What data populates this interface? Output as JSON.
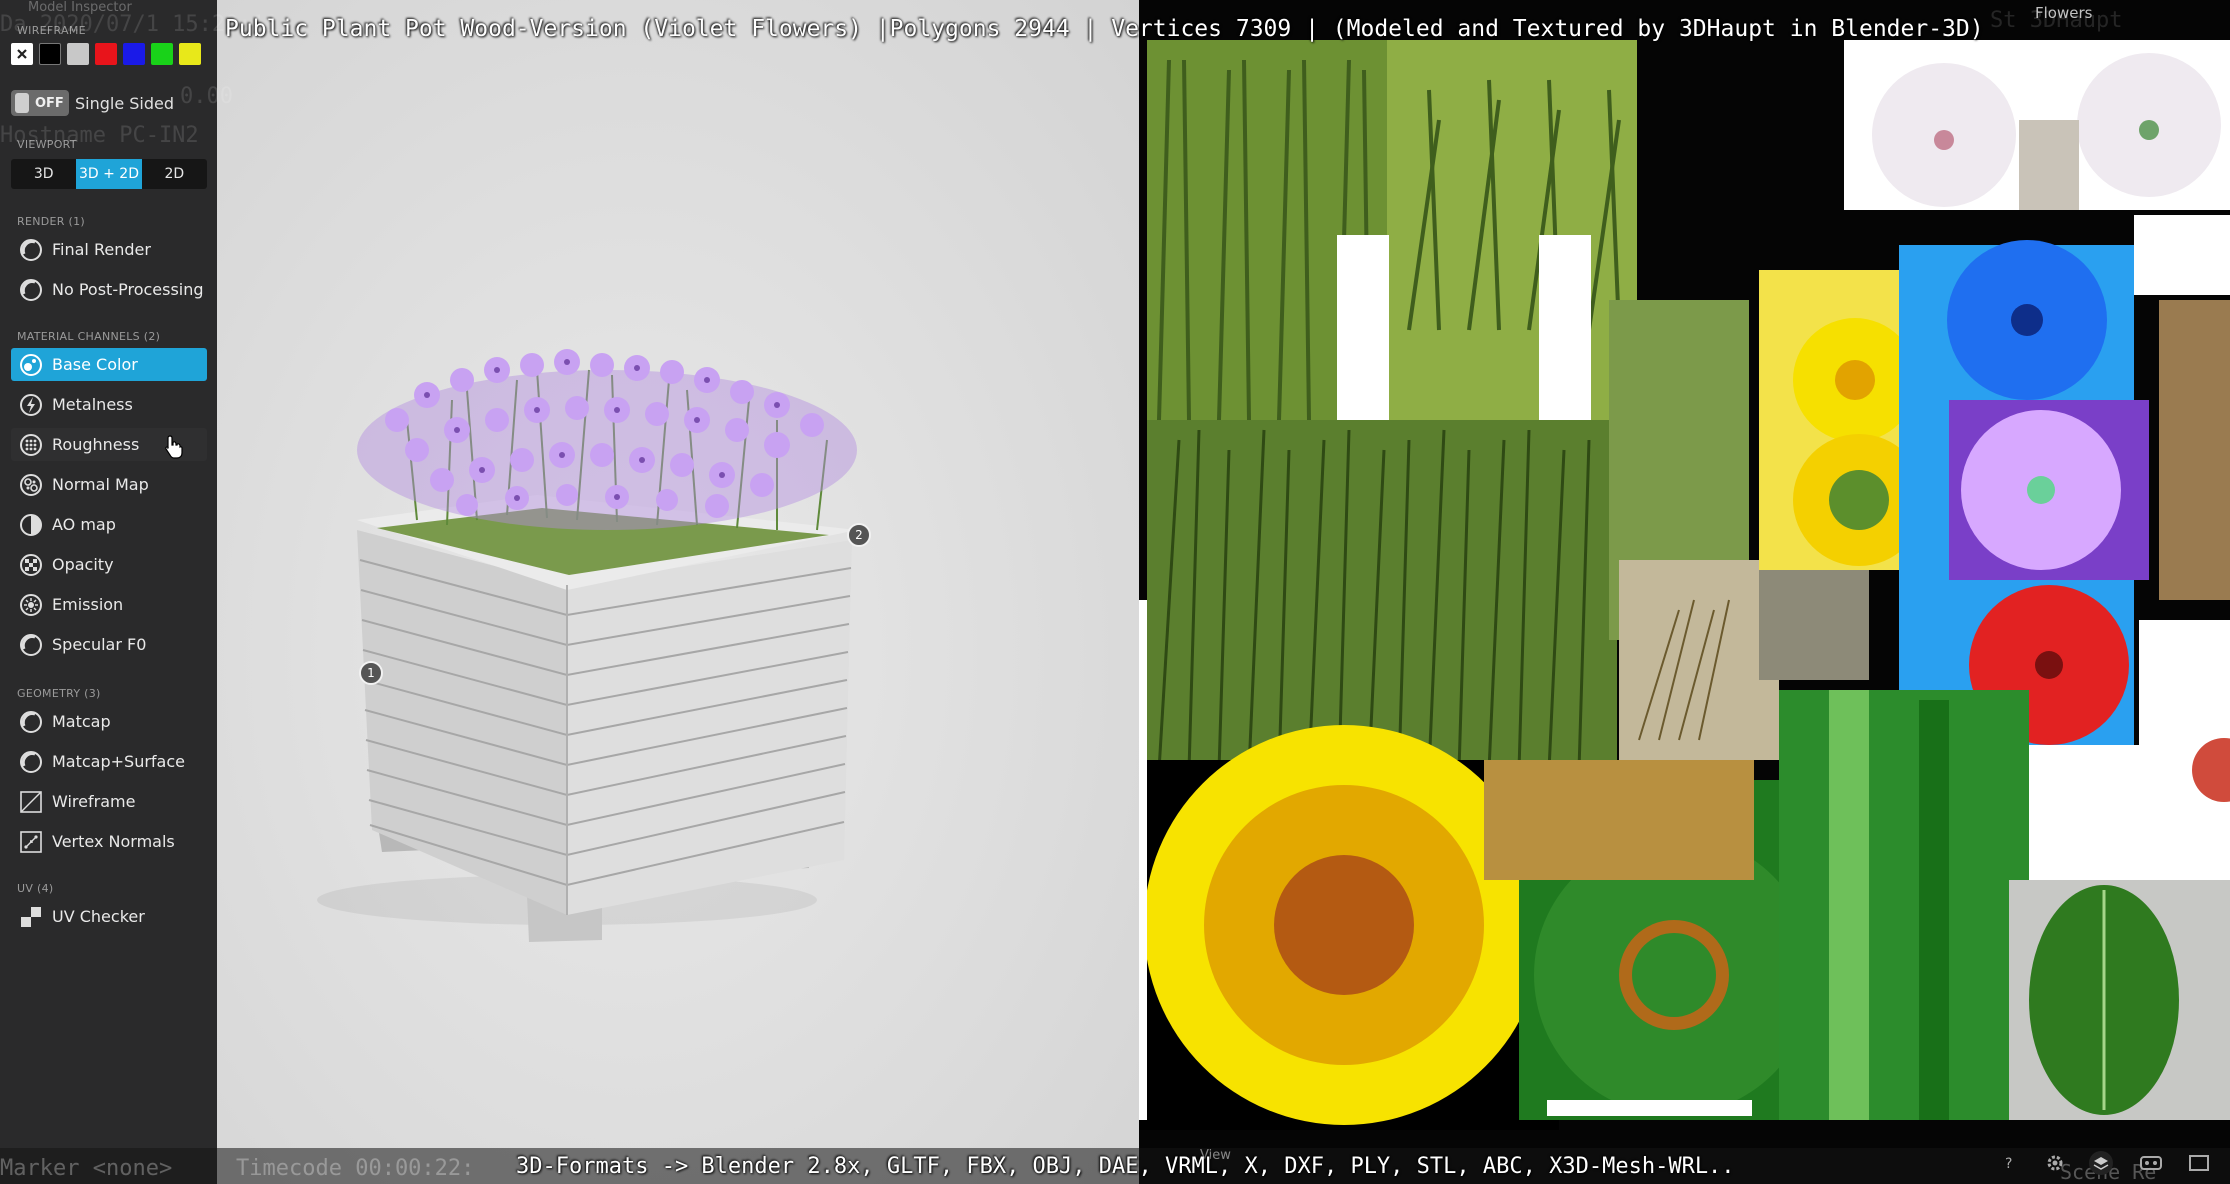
{
  "overlay": {
    "title": "Public Plant Pot Wood-Version (Violet Flowers) |Polygons 2944 | Vertices 7309 | (Modeled and Textured by 3DHaupt in Blender-3D)",
    "formats": "3D-Formats -> Blender 2.8x, GLTF, FBX, OBJ, DAE, VRML, X, DXF, PLY, STL, ABC, X3D-Mesh-WRL..",
    "ghost_top_left": "Model Inspector",
    "ghost_date": "Da 2020/07/1 15:20:11",
    "ghost_num": "0.00",
    "ghost_hostname": "Hostname PC-IN2",
    "ghost_marker": "Marker <none>",
    "ghost_timecode": "Timecode 00:00:22:",
    "ghost_right": "St    3DHaupt",
    "ghost_right_bottom": "Scene Re",
    "texture_label": "Flowers",
    "view_label": "View"
  },
  "sidebar": {
    "wireframe_heading": "WIREFRAME",
    "swatch_colors": [
      "#ffffff",
      "#000000",
      "#c8c8c8",
      "#e8141b",
      "#1a1ae8",
      "#19d219",
      "#e8e81a"
    ],
    "toggle_state": "OFF",
    "toggle_label": "Single Sided",
    "viewport_heading": "VIEWPORT",
    "viewport_modes": [
      "3D",
      "3D + 2D",
      "2D"
    ],
    "viewport_active": "3D + 2D",
    "render_heading": "RENDER (1)",
    "render_items": [
      {
        "label": "Final Render",
        "icon": "render-circle-icon"
      },
      {
        "label": "No Post-Processing",
        "icon": "render-circle-icon"
      }
    ],
    "material_heading": "MATERIAL CHANNELS (2)",
    "material_items": [
      {
        "label": "Base Color",
        "icon": "palette-icon",
        "active": true
      },
      {
        "label": "Metalness",
        "icon": "metal-icon"
      },
      {
        "label": "Roughness",
        "icon": "roughness-icon"
      },
      {
        "label": "Normal Map",
        "icon": "normal-map-icon"
      },
      {
        "label": "AO map",
        "icon": "ao-map-icon"
      },
      {
        "label": "Opacity",
        "icon": "opacity-icon"
      },
      {
        "label": "Emission",
        "icon": "emission-icon"
      },
      {
        "label": "Specular F0",
        "icon": "specular-icon"
      }
    ],
    "geometry_heading": "GEOMETRY (3)",
    "geometry_items": [
      {
        "label": "Matcap",
        "icon": "matcap-icon"
      },
      {
        "label": "Matcap+Surface",
        "icon": "matcap-surface-icon"
      },
      {
        "label": "Wireframe",
        "icon": "wireframe-icon"
      },
      {
        "label": "Vertex Normals",
        "icon": "vertex-normals-icon"
      }
    ],
    "uv_heading": "UV (4)",
    "uv_items": [
      {
        "label": "UV Checker",
        "icon": "uv-checker-icon"
      }
    ]
  },
  "viewport": {
    "annotations": [
      "1",
      "2"
    ],
    "accent_color": "#1fa4d8"
  }
}
